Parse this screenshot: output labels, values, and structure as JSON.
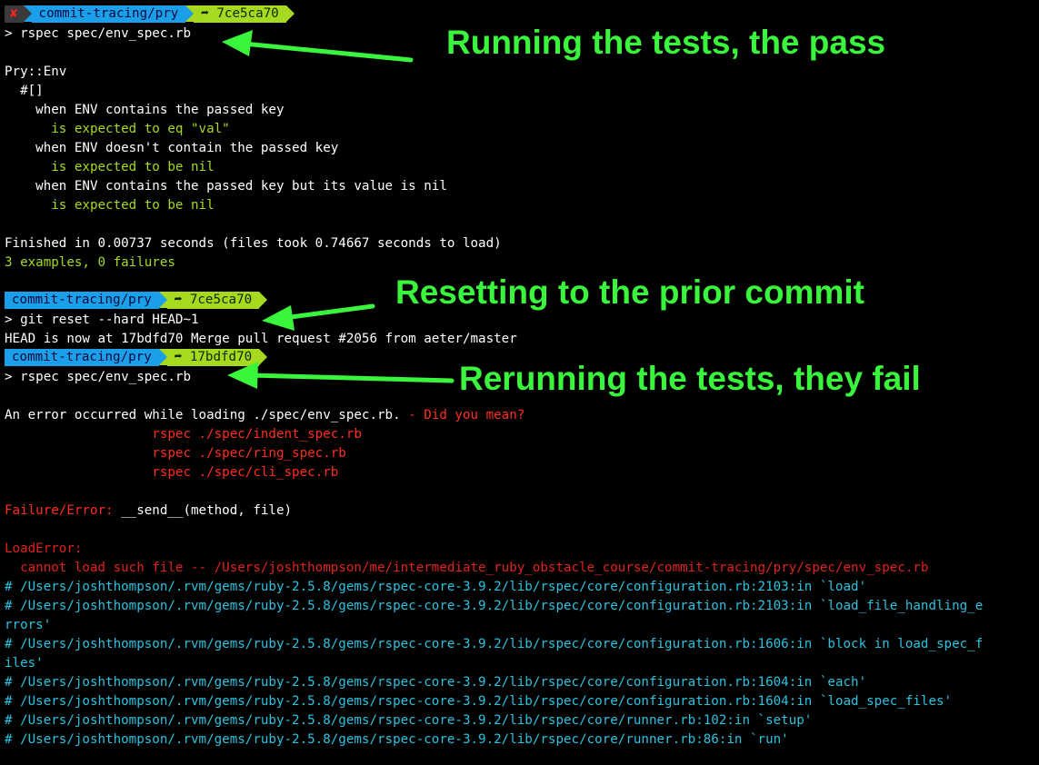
{
  "prompts": [
    {
      "error_mark": "✘",
      "dir": "commit-tracing/pry",
      "git": "➦ 7ce5ca70"
    },
    {
      "dir": "commit-tracing/pry",
      "git": "➦ 7ce5ca70"
    },
    {
      "dir": "commit-tracing/pry",
      "git": "➦ 17bdfd70"
    }
  ],
  "lines": {
    "cmd1": "> rspec spec/env_spec.rb",
    "suite": "Pry::Env",
    "method": "  #[]",
    "ctx1": "    when ENV contains the passed key",
    "exp1": "      is expected to eq \"val\"",
    "ctx2": "    when ENV doesn't contain the passed key",
    "exp2": "      is expected to be nil",
    "ctx3": "    when ENV contains the passed key but its value is nil",
    "exp3": "      is expected to be nil",
    "finished": "Finished in 0.00737 seconds (files took 0.74667 seconds to load)",
    "summary": "3 examples, 0 failures",
    "cmd2": "> git reset --hard HEAD~1",
    "head": "HEAD is now at 17bdfd70 Merge pull request #2056 from aeter/master",
    "cmd3": "> rspec spec/env_spec.rb",
    "err_main": "An error occurred while loading ./spec/env_spec.rb.",
    "did_you_mean": " - Did you mean?",
    "sugg1": "                   rspec ./spec/indent_spec.rb",
    "sugg2": "                   rspec ./spec/ring_spec.rb",
    "sugg3": "                   rspec ./spec/cli_spec.rb",
    "failure_label": "Failure/Error:",
    "failure_code": " __send__(method, file)",
    "load_error": "LoadError:",
    "load_error_msg": "  cannot load such file -- /Users/joshthompson/me/intermediate_ruby_obstacle_course/commit-tracing/pry/spec/env_spec.rb",
    "bt1": "# /Users/joshthompson/.rvm/gems/ruby-2.5.8/gems/rspec-core-3.9.2/lib/rspec/core/configuration.rb:2103:in `load'",
    "bt2a": "# /Users/joshthompson/.rvm/gems/ruby-2.5.8/gems/rspec-core-3.9.2/lib/rspec/core/configuration.rb:2103:in `load_file_handling_e",
    "bt2b": "rrors'",
    "bt3a": "# /Users/joshthompson/.rvm/gems/ruby-2.5.8/gems/rspec-core-3.9.2/lib/rspec/core/configuration.rb:1606:in `block in load_spec_f",
    "bt3b": "iles'",
    "bt4": "# /Users/joshthompson/.rvm/gems/ruby-2.5.8/gems/rspec-core-3.9.2/lib/rspec/core/configuration.rb:1604:in `each'",
    "bt5": "# /Users/joshthompson/.rvm/gems/ruby-2.5.8/gems/rspec-core-3.9.2/lib/rspec/core/configuration.rb:1604:in `load_spec_files'",
    "bt6": "# /Users/joshthompson/.rvm/gems/ruby-2.5.8/gems/rspec-core-3.9.2/lib/rspec/core/runner.rb:102:in `setup'",
    "bt7": "# /Users/joshthompson/.rvm/gems/ruby-2.5.8/gems/rspec-core-3.9.2/lib/rspec/core/runner.rb:86:in `run'"
  },
  "annotations": {
    "a1": "Running the tests, the pass",
    "a2": "Resetting to the prior commit",
    "a3": "Rerunning the tests, they fail"
  },
  "colors": {
    "background": "#000000",
    "pass": "#a6d91f",
    "error": "#ff2d1f",
    "backtrace": "#2bc2e0",
    "annotation": "#39f53b",
    "prompt_dir": "#1a9fe8",
    "prompt_git": "#a6d91f"
  }
}
